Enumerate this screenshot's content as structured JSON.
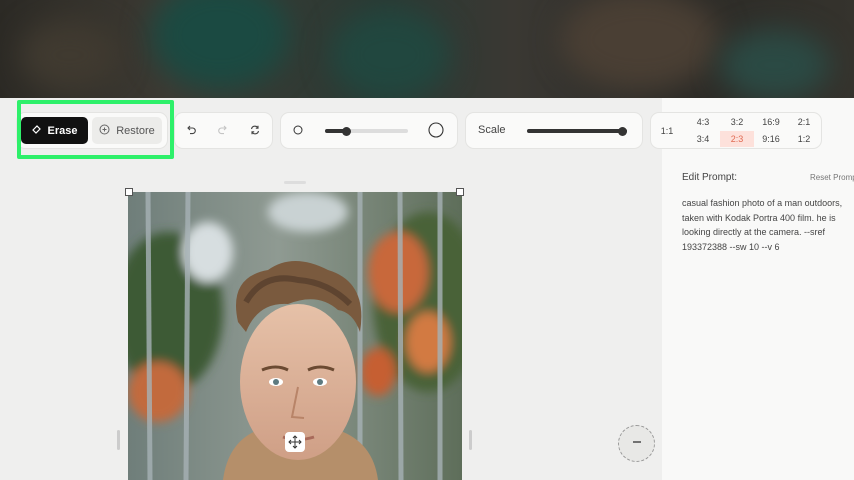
{
  "toolbar": {
    "erase_label": "Erase",
    "restore_label": "Restore",
    "brush_size_level": 0.25,
    "scale_level": 1.0,
    "scale_label": "Scale"
  },
  "aspect_ratios": {
    "options": [
      "1:1",
      "4:3",
      "3:2",
      "16:9",
      "2:1",
      "3:4",
      "2:3",
      "9:16",
      "1:2"
    ],
    "selected": "2:3"
  },
  "prompt_panel": {
    "heading": "Edit Prompt:",
    "reset_label": "Reset Prompt",
    "lines": [
      "casual fashion photo of a man outdoors,",
      "taken with Kodak Portra 400 film. he is",
      "looking directly at the camera. --sref",
      "193372388 --sw 10 --v 6"
    ]
  },
  "icons": [
    "eraser-icon",
    "plus-circle-icon",
    "undo-icon",
    "redo-icon",
    "refresh-icon",
    "brush-small-icon",
    "brush-large-icon",
    "move-icon",
    "minus-icon"
  ],
  "colors": {
    "highlight": "#2ef06a",
    "accent": "#e06a52",
    "active_cell_bg": "#fde1db"
  }
}
